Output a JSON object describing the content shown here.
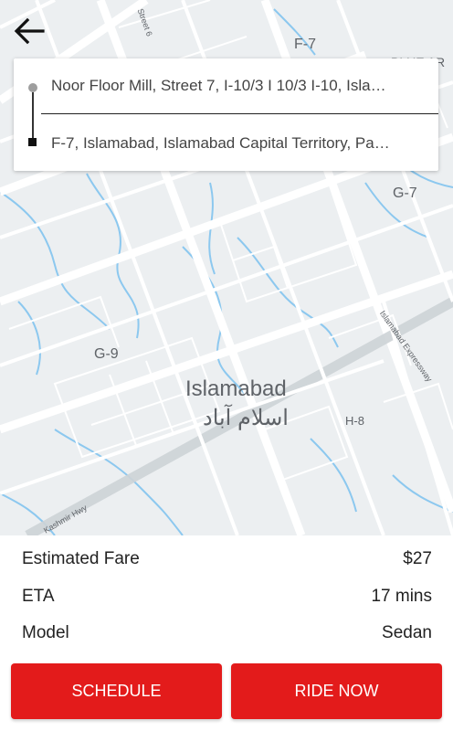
{
  "header": {
    "back_icon": "arrow-left-icon"
  },
  "route": {
    "origin": "Noor Floor Mill, Street 7, I-10/3 I 10/3 I-10, Isla…",
    "destination": "F-7, Islamabad, Islamabad Capital Territory, Pa…"
  },
  "map": {
    "city_name": "Islamabad",
    "city_name_urdu": "اسلام آباد",
    "sector_labels": [
      "F-7",
      "G-7",
      "G-9",
      "H-8"
    ],
    "road_labels": [
      "Street 6",
      "Kashmir Hwy",
      "Islamabad Expressway"
    ],
    "partial_label": "BLUE AR"
  },
  "trip": {
    "fare_label": "Estimated Fare",
    "fare_value": "$27",
    "eta_label": "ETA",
    "eta_value": "17 mins",
    "model_label": "Model",
    "model_value": "Sedan"
  },
  "actions": {
    "schedule_label": "SCHEDULE",
    "ride_now_label": "RIDE NOW"
  },
  "colors": {
    "accent": "#e31b1b",
    "map_background": "#eceff1",
    "water": "#8cc8ef"
  }
}
